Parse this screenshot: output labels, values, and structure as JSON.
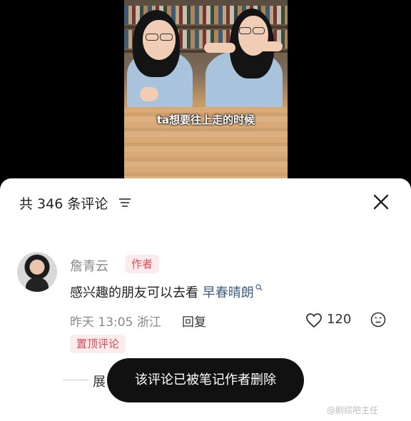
{
  "video": {
    "subtitle": "ta想要往上走的时候"
  },
  "comments_panel": {
    "title": "共 346 条评论",
    "comment": {
      "username": "詹青云",
      "author_badge": "作者",
      "text": "感兴趣的朋友可以去看",
      "link_text": "早春晴朗",
      "time": "昨天 13:05",
      "location": "浙江",
      "reply_label": "回复",
      "likes": "120",
      "pinned_label": "置顶评论"
    },
    "expand_label": "展"
  },
  "toast": {
    "text": "该评论已被笔记作者删除"
  },
  "watermark": {
    "text": "@剧综吧主任"
  },
  "icons": [
    "sort-icon",
    "close-icon",
    "search-icon",
    "heart-icon",
    "emoji-icon"
  ]
}
